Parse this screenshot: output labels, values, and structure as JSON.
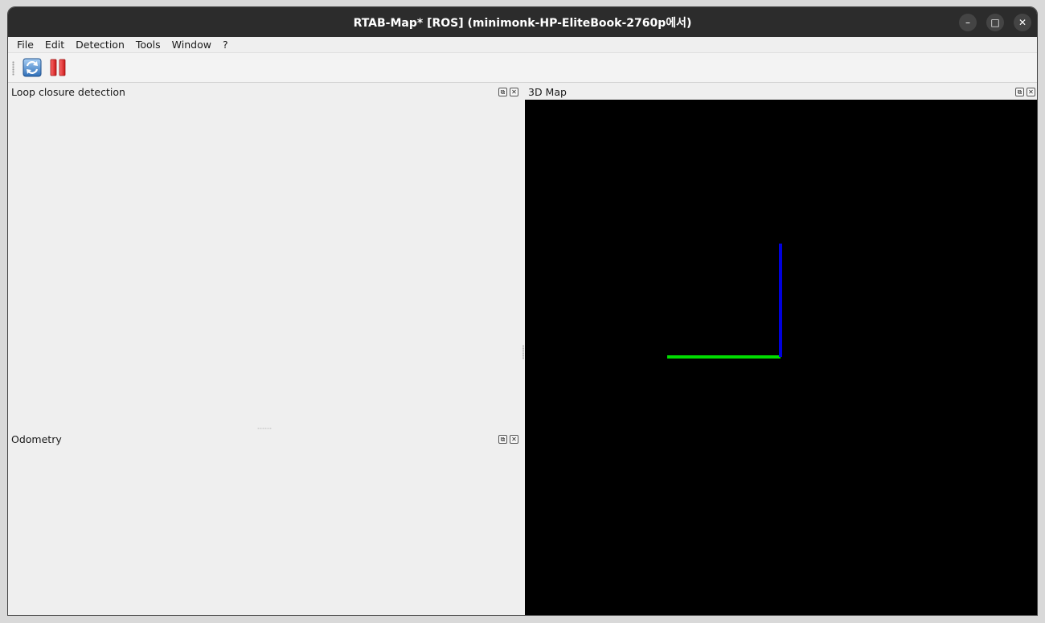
{
  "window": {
    "title": "RTAB-Map* [ROS] (minimonk-HP-EliteBook-2760p에서)",
    "minimize_label": "–",
    "maximize_label": "□",
    "close_label": "✕"
  },
  "menu": {
    "items": [
      "File",
      "Edit",
      "Detection",
      "Tools",
      "Window",
      "?"
    ]
  },
  "toolbar": {
    "buttons": [
      {
        "icon": "refresh-icon"
      },
      {
        "icon": "pause-icon"
      }
    ]
  },
  "docks": {
    "loop_closure": {
      "title": "Loop closure detection",
      "float_label": "⧉",
      "close_label": "✕"
    },
    "odometry": {
      "title": "Odometry",
      "float_label": "⧉",
      "close_label": "✕"
    },
    "map3d": {
      "title": "3D Map",
      "float_label": "⧉",
      "close_label": "✕"
    }
  },
  "map_view": {
    "background": "#000000",
    "axes": [
      {
        "name": "y-axis",
        "color": "#00dd00"
      },
      {
        "name": "z-axis",
        "color": "#0000dd"
      }
    ]
  }
}
